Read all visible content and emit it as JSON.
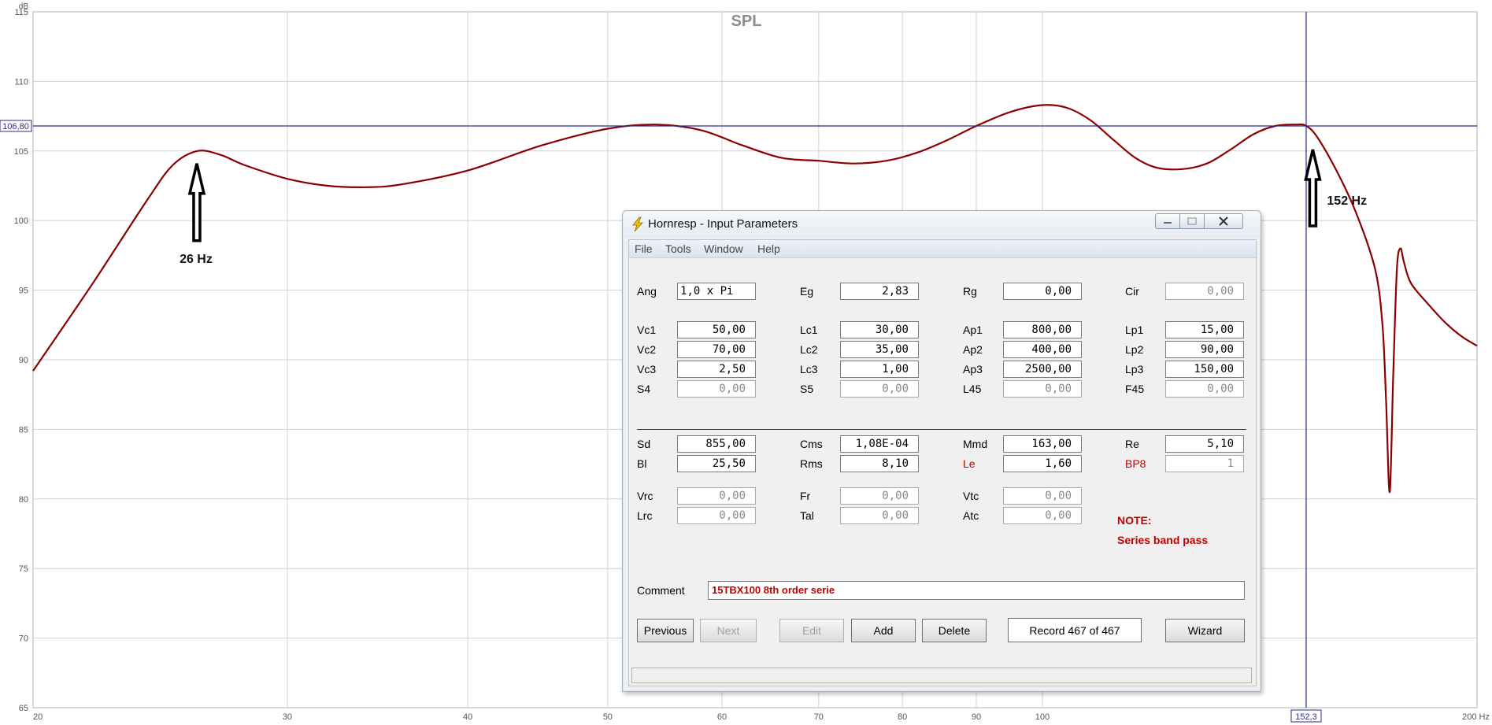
{
  "chart_data": {
    "type": "line",
    "title": "SPL",
    "y_unit": "dB",
    "x_unit": "Hz",
    "x_scale": "log",
    "xlim": [
      20,
      200
    ],
    "ylim": [
      65,
      115
    ],
    "x_ticks": [
      20,
      30,
      40,
      50,
      60,
      70,
      80,
      90,
      100,
      200
    ],
    "x_tick_labels": [
      "20",
      "30",
      "40",
      "50",
      "60",
      "70",
      "80",
      "90",
      "100",
      "200 Hz"
    ],
    "y_ticks": [
      65,
      70,
      75,
      80,
      85,
      90,
      95,
      100,
      105,
      110,
      115
    ],
    "grid": true,
    "color": "#8b0000",
    "cursor": {
      "x": 152.3,
      "y": 106.8,
      "x_label": "152,3",
      "y_label": "106,80"
    },
    "annotations": [
      {
        "text": "26 Hz",
        "x": 26,
        "y": 105
      },
      {
        "text": "152 Hz",
        "x": 152,
        "y": 106.8
      }
    ],
    "series": [
      {
        "x": [
          20,
          22,
          24,
          25,
          26,
          27,
          28,
          30,
          32,
          34,
          36,
          40,
          45,
          50,
          54,
          58,
          62,
          66,
          70,
          74,
          78,
          82,
          86,
          90,
          95,
          100,
          104,
          108,
          112,
          116,
          120,
          125,
          130,
          135,
          140,
          145,
          150,
          152.3,
          155,
          160,
          165,
          170,
          172,
          173,
          174,
          175,
          176,
          177,
          178,
          180,
          185,
          190,
          195,
          200
        ],
        "y": [
          89.2,
          95.5,
          101.5,
          104.0,
          105.0,
          104.7,
          104.0,
          103.0,
          102.5,
          102.4,
          102.6,
          103.6,
          105.4,
          106.6,
          106.9,
          106.5,
          105.4,
          104.5,
          104.3,
          104.1,
          104.3,
          104.9,
          105.8,
          106.8,
          107.8,
          108.3,
          108.1,
          107.2,
          105.8,
          104.5,
          103.8,
          103.7,
          104.1,
          105.1,
          106.2,
          106.8,
          106.9,
          106.8,
          106.0,
          103.5,
          100.5,
          96.5,
          92.5,
          87.0,
          80.5,
          89.0,
          96.5,
          98.0,
          97.0,
          95.5,
          94.0,
          92.7,
          91.7,
          91.0
        ]
      }
    ]
  },
  "dialog": {
    "title": "Hornresp - Input Parameters",
    "menu": [
      "File",
      "Tools",
      "Window",
      "Help"
    ],
    "params": [
      {
        "label": "Ang",
        "value": "1,0 x Pi",
        "disabled": false
      },
      {
        "label": "Eg",
        "value": "2,83",
        "disabled": false
      },
      {
        "label": "Rg",
        "value": "0,00",
        "disabled": false
      },
      {
        "label": "Cir",
        "value": "0,00",
        "disabled": true
      },
      {
        "label": "Vc1",
        "value": "50,00",
        "disabled": false
      },
      {
        "label": "Lc1",
        "value": "30,00",
        "disabled": false
      },
      {
        "label": "Ap1",
        "value": "800,00",
        "disabled": false
      },
      {
        "label": "Lp1",
        "value": "15,00",
        "disabled": false
      },
      {
        "label": "Vc2",
        "value": "70,00",
        "disabled": false
      },
      {
        "label": "Lc2",
        "value": "35,00",
        "disabled": false
      },
      {
        "label": "Ap2",
        "value": "400,00",
        "disabled": false
      },
      {
        "label": "Lp2",
        "value": "90,00",
        "disabled": false
      },
      {
        "label": "Vc3",
        "value": "2,50",
        "disabled": false
      },
      {
        "label": "Lc3",
        "value": "1,00",
        "disabled": false
      },
      {
        "label": "Ap3",
        "value": "2500,00",
        "disabled": false
      },
      {
        "label": "Lp3",
        "value": "150,00",
        "disabled": false
      },
      {
        "label": "S4",
        "value": "0,00",
        "disabled": true
      },
      {
        "label": "S5",
        "value": "0,00",
        "disabled": true
      },
      {
        "label": "L45",
        "value": "0,00",
        "disabled": true
      },
      {
        "label": "F45",
        "value": "0,00",
        "disabled": true
      },
      {
        "label": "Sd",
        "value": "855,00",
        "disabled": false
      },
      {
        "label": "Cms",
        "value": "1,08E-04",
        "disabled": false
      },
      {
        "label": "Mmd",
        "value": "163,00",
        "disabled": false
      },
      {
        "label": "Re",
        "value": "5,10",
        "disabled": false
      },
      {
        "label": "Bl",
        "value": "25,50",
        "disabled": false
      },
      {
        "label": "Rms",
        "value": "8,10",
        "disabled": false
      },
      {
        "label": "Le",
        "value": "1,60",
        "disabled": false,
        "red": true
      },
      {
        "label": "BP8",
        "value": "1",
        "disabled": true,
        "red": true
      },
      {
        "label": "Vrc",
        "value": "0,00",
        "disabled": true
      },
      {
        "label": "Fr",
        "value": "0,00",
        "disabled": true
      },
      {
        "label": "Vtc",
        "value": "0,00",
        "disabled": true
      },
      {
        "label": "Lrc",
        "value": "0,00",
        "disabled": true
      },
      {
        "label": "Tal",
        "value": "0,00",
        "disabled": true
      },
      {
        "label": "Atc",
        "value": "0,00",
        "disabled": true
      }
    ],
    "note_label": "NOTE:",
    "note_text": "Series band pass",
    "comment_label": "Comment",
    "comment_value": "15TBX100 8th order serie",
    "buttons": {
      "previous": "Previous",
      "next": "Next",
      "edit": "Edit",
      "add": "Add",
      "delete": "Delete",
      "wizard": "Wizard"
    },
    "record": "Record 467 of 467"
  }
}
